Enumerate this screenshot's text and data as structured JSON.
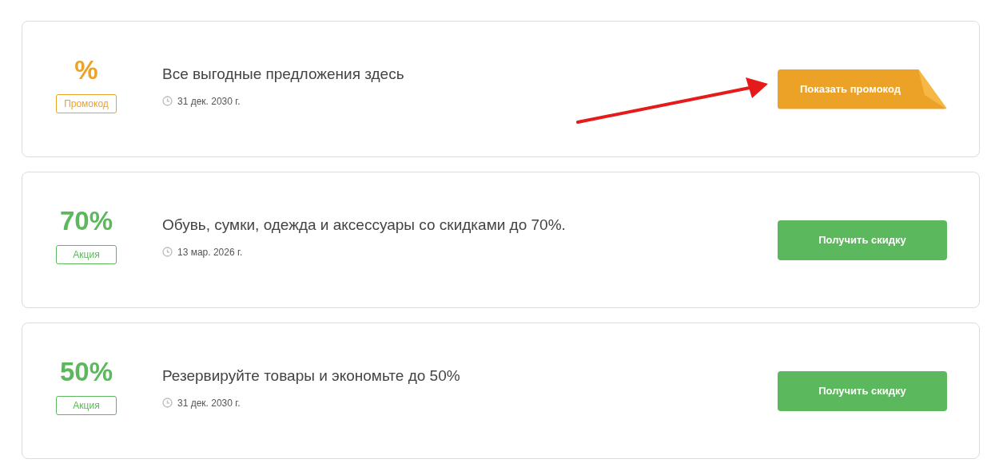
{
  "offers": [
    {
      "kind": "promo",
      "value": "%",
      "badge": "Промокод",
      "title": "Все выгодные предложения здесь",
      "date": "31 дек. 2030 г.",
      "button": "Показать промокод",
      "arrow": true
    },
    {
      "kind": "sale",
      "value": "70%",
      "badge": "Акция",
      "title": "Обувь, сумки, одежда и аксессуары со скидками до 70%.",
      "date": "13 мар. 2026 г.",
      "button": "Получить скидку",
      "arrow": false
    },
    {
      "kind": "sale",
      "value": "50%",
      "badge": "Акция",
      "title": "Резервируйте товары и экономьте до 50%",
      "date": "31 дек. 2030 г.",
      "button": "Получить скидку",
      "arrow": false
    }
  ]
}
